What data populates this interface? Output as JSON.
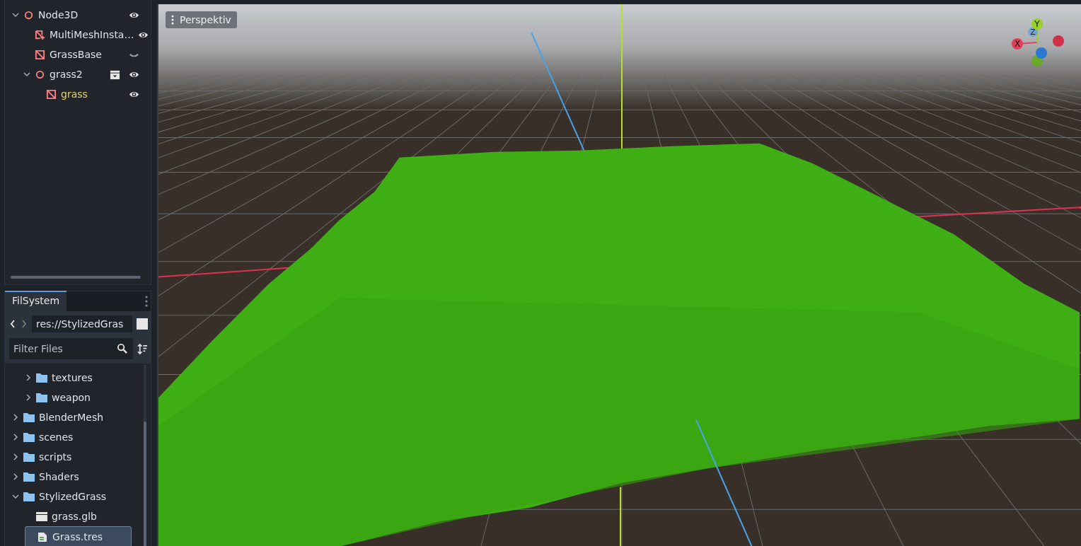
{
  "scene_tree": {
    "nodes": [
      {
        "name": "Node3D",
        "kind": "node3d",
        "visible": true,
        "instanced": false,
        "highlighted": false,
        "expanded": true,
        "children": [
          {
            "name": "MultiMeshInsta…",
            "kind": "multimesh",
            "visible": true,
            "instanced": false,
            "highlighted": false
          },
          {
            "name": "GrassBase",
            "kind": "mesh",
            "visible": false,
            "instanced": false,
            "highlighted": false
          },
          {
            "name": "grass2",
            "kind": "node3d",
            "visible": true,
            "instanced": true,
            "highlighted": false,
            "expanded": true,
            "children": [
              {
                "name": "grass",
                "kind": "mesh",
                "visible": true,
                "instanced": false,
                "highlighted": true
              }
            ]
          }
        ]
      }
    ]
  },
  "filesystem": {
    "tab": "FilSystem",
    "path": "res://StylizedGras",
    "filter": {
      "placeholder": "Filter Files"
    },
    "items": [
      {
        "children": [
          {
            "name": "textures",
            "kind": "folder",
            "expanded": false,
            "selected": false
          },
          {
            "name": "weapon",
            "kind": "folder",
            "expanded": false,
            "selected": false
          }
        ]
      },
      {
        "name": "BlenderMesh",
        "kind": "folder",
        "expanded": false,
        "selected": false
      },
      {
        "name": "scenes",
        "kind": "folder",
        "expanded": false,
        "selected": false
      },
      {
        "name": "scripts",
        "kind": "folder",
        "expanded": false,
        "selected": false
      },
      {
        "name": "Shaders",
        "kind": "folder",
        "expanded": false,
        "selected": false
      },
      {
        "name": "StylizedGrass",
        "kind": "folder",
        "expanded": true,
        "selected": false,
        "children": [
          {
            "name": "grass.glb",
            "kind": "scene",
            "selected": false
          },
          {
            "name": "Grass.tres",
            "kind": "resource",
            "selected": true
          }
        ]
      }
    ]
  },
  "viewport": {
    "view_menu": "Perspektiv",
    "gizmo": {
      "x": "X",
      "y": "Y",
      "z": "Z"
    }
  }
}
